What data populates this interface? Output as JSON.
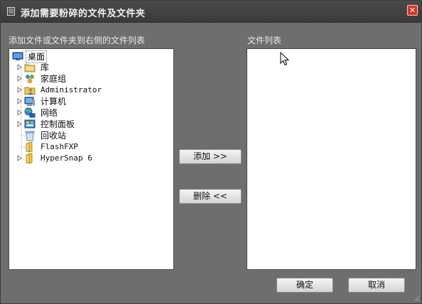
{
  "window": {
    "title": "添加需要粉碎的文件及文件夹",
    "close_label": "✕"
  },
  "left_panel": {
    "label": "添加文件或文件夹到右侧的文件列表",
    "root": {
      "label": "桌面",
      "icon": "desktop-icon"
    },
    "nodes": [
      {
        "label": "库",
        "icon": "library-icon",
        "expandable": true
      },
      {
        "label": "家庭组",
        "icon": "homegroup-icon",
        "expandable": true
      },
      {
        "label": "Administrator",
        "icon": "user-icon",
        "expandable": true
      },
      {
        "label": "计算机",
        "icon": "computer-icon",
        "expandable": true
      },
      {
        "label": "网络",
        "icon": "network-icon",
        "expandable": true
      },
      {
        "label": "控制面板",
        "icon": "control-panel-icon",
        "expandable": true
      },
      {
        "label": "回收站",
        "icon": "recycle-bin-icon",
        "expandable": false
      },
      {
        "label": "FlashFXP",
        "icon": "folder-icon",
        "expandable": false
      },
      {
        "label": "HyperSnap 6",
        "icon": "folder-icon",
        "expandable": true
      }
    ]
  },
  "right_panel": {
    "label": "文件列表"
  },
  "buttons": {
    "add": "添加 >>",
    "delete": "删除 <<",
    "ok": "确定",
    "cancel": "取消"
  }
}
